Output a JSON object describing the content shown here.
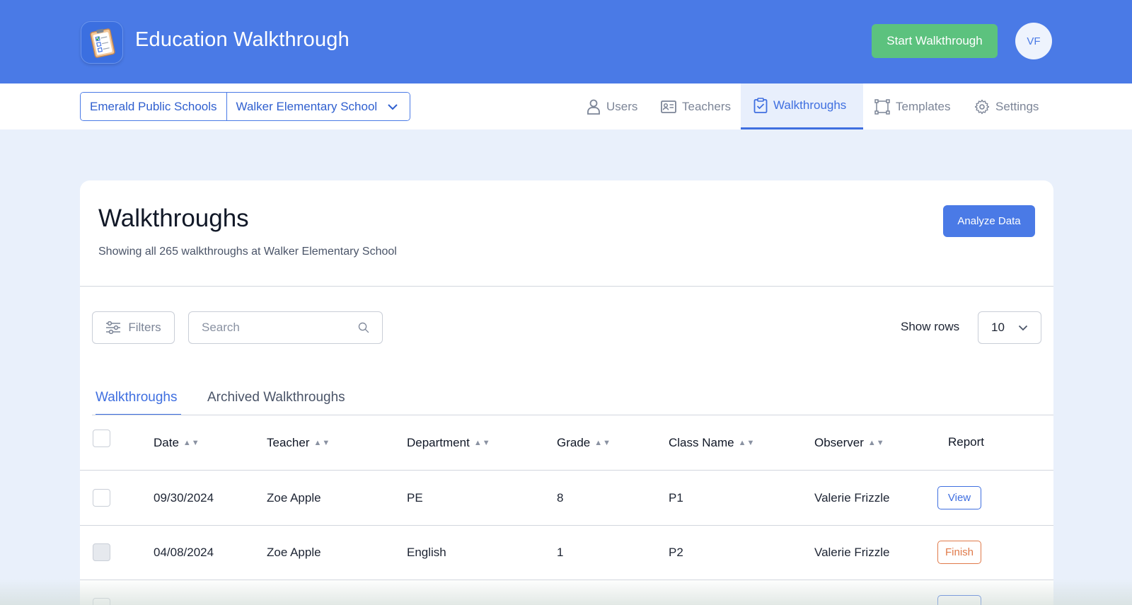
{
  "header": {
    "app_title": "Education Walkthrough",
    "start_button": "Start Walkthrough",
    "avatar_initials": "VF",
    "logo_icon": "clipboard-checklist-icon"
  },
  "org_selector": {
    "district": "Emerald Public Schools",
    "school": "Walker Elementary School"
  },
  "nav": {
    "items": [
      {
        "label": "Users",
        "icon": "user-icon",
        "active": false
      },
      {
        "label": "Teachers",
        "icon": "id-card-icon",
        "active": false
      },
      {
        "label": "Walkthroughs",
        "icon": "clipboard-check-icon",
        "active": true
      },
      {
        "label": "Templates",
        "icon": "template-frame-icon",
        "active": false
      },
      {
        "label": "Settings",
        "icon": "gear-icon",
        "active": false
      }
    ]
  },
  "page": {
    "title": "Walkthroughs",
    "subtitle": "Showing all 265 walkthroughs at Walker Elementary School",
    "analyze_button": "Analyze Data"
  },
  "toolbar": {
    "filters_label": "Filters",
    "search_placeholder": "Search",
    "show_rows_label": "Show rows",
    "rows_value": "10"
  },
  "tabs": [
    {
      "label": "Walkthroughs",
      "active": true
    },
    {
      "label": "Archived Walkthroughs",
      "active": false
    }
  ],
  "table": {
    "columns": [
      "Date",
      "Teacher",
      "Department",
      "Grade",
      "Class Name",
      "Observer",
      "Report"
    ],
    "rows": [
      {
        "date": "09/30/2024",
        "teacher": "Zoe Apple",
        "department": "PE",
        "grade": "8",
        "class_name": "P1",
        "observer": "Valerie Frizzle",
        "report": "View"
      },
      {
        "date": "04/08/2024",
        "teacher": "Zoe Apple",
        "department": "English",
        "grade": "1",
        "class_name": "P2",
        "observer": "Valerie Frizzle",
        "report": "Finish"
      }
    ]
  },
  "colors": {
    "brand_blue": "#4a7ae6",
    "start_green": "#5cc27e",
    "finish_orange": "#e07a4a"
  }
}
